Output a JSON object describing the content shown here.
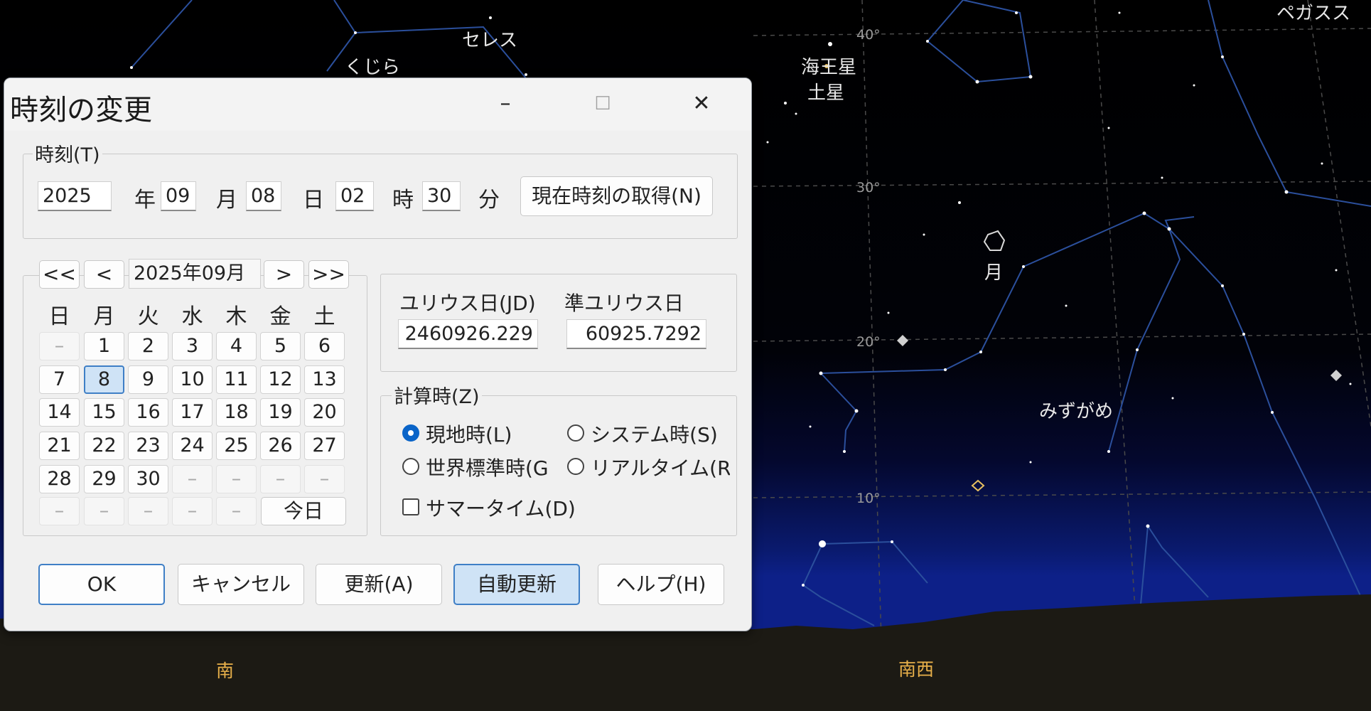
{
  "sky": {
    "labels": {
      "pegasus": "ペガスス",
      "ceres": "セレス",
      "cetus": "くじら",
      "neptune": "海王星",
      "saturn": "土星",
      "moon": "月",
      "aquarius": "みずがめ"
    },
    "altitude_marks": [
      "40°",
      "30°",
      "20°",
      "10°"
    ],
    "directions": {
      "south": "南",
      "southwest": "南西"
    }
  },
  "dialog": {
    "title": "時刻の変更",
    "window_buttons": {
      "minimize": "–",
      "maximize": "☐",
      "close": "✕"
    },
    "time_group": {
      "label": "時刻(T)",
      "year": "2025",
      "year_unit": "年",
      "month": "09",
      "month_unit": "月",
      "day": "08",
      "day_unit": "日",
      "hour": "02",
      "hour_unit": "時",
      "minute": "30",
      "minute_unit": "分",
      "get_now_button": "現在時刻の取得(N)"
    },
    "calendar": {
      "nav": {
        "prev_year": "<<",
        "prev_month": "<",
        "month_label": "2025年09月",
        "next_month": ">",
        "next_year": ">>"
      },
      "weekdays": [
        "日",
        "月",
        "火",
        "水",
        "木",
        "金",
        "土"
      ],
      "empty_mark": "–",
      "rows": [
        [
          "–",
          "1",
          "2",
          "3",
          "4",
          "5",
          "6"
        ],
        [
          "7",
          "8",
          "9",
          "10",
          "11",
          "12",
          "13"
        ],
        [
          "14",
          "15",
          "16",
          "17",
          "18",
          "19",
          "20"
        ],
        [
          "21",
          "22",
          "23",
          "24",
          "25",
          "26",
          "27"
        ],
        [
          "28",
          "29",
          "30",
          "–",
          "–",
          "–",
          "–"
        ],
        [
          "–",
          "–",
          "–",
          "–",
          "–"
        ]
      ],
      "selected_day": "8",
      "today_button": "今日"
    },
    "julian": {
      "jd_label": "ユリウス日(JD)",
      "jd_value": "2460926.229",
      "mjd_label": "準ユリウス日",
      "mjd_value": "60925.7292"
    },
    "calc_group": {
      "label": "計算時(Z)",
      "options": [
        {
          "label": "現地時(L)",
          "selected": true
        },
        {
          "label": "システム時(S)",
          "selected": false
        },
        {
          "label": "世界標準時(G",
          "selected": false
        },
        {
          "label": "リアルタイム(R",
          "selected": false
        }
      ],
      "summer_time_label": "サマータイム(D)",
      "summer_time_checked": false
    },
    "buttons": {
      "ok": "OK",
      "cancel": "キャンセル",
      "update": "更新(A)",
      "auto_update": "自動更新",
      "help": "ヘルプ(H)"
    }
  }
}
